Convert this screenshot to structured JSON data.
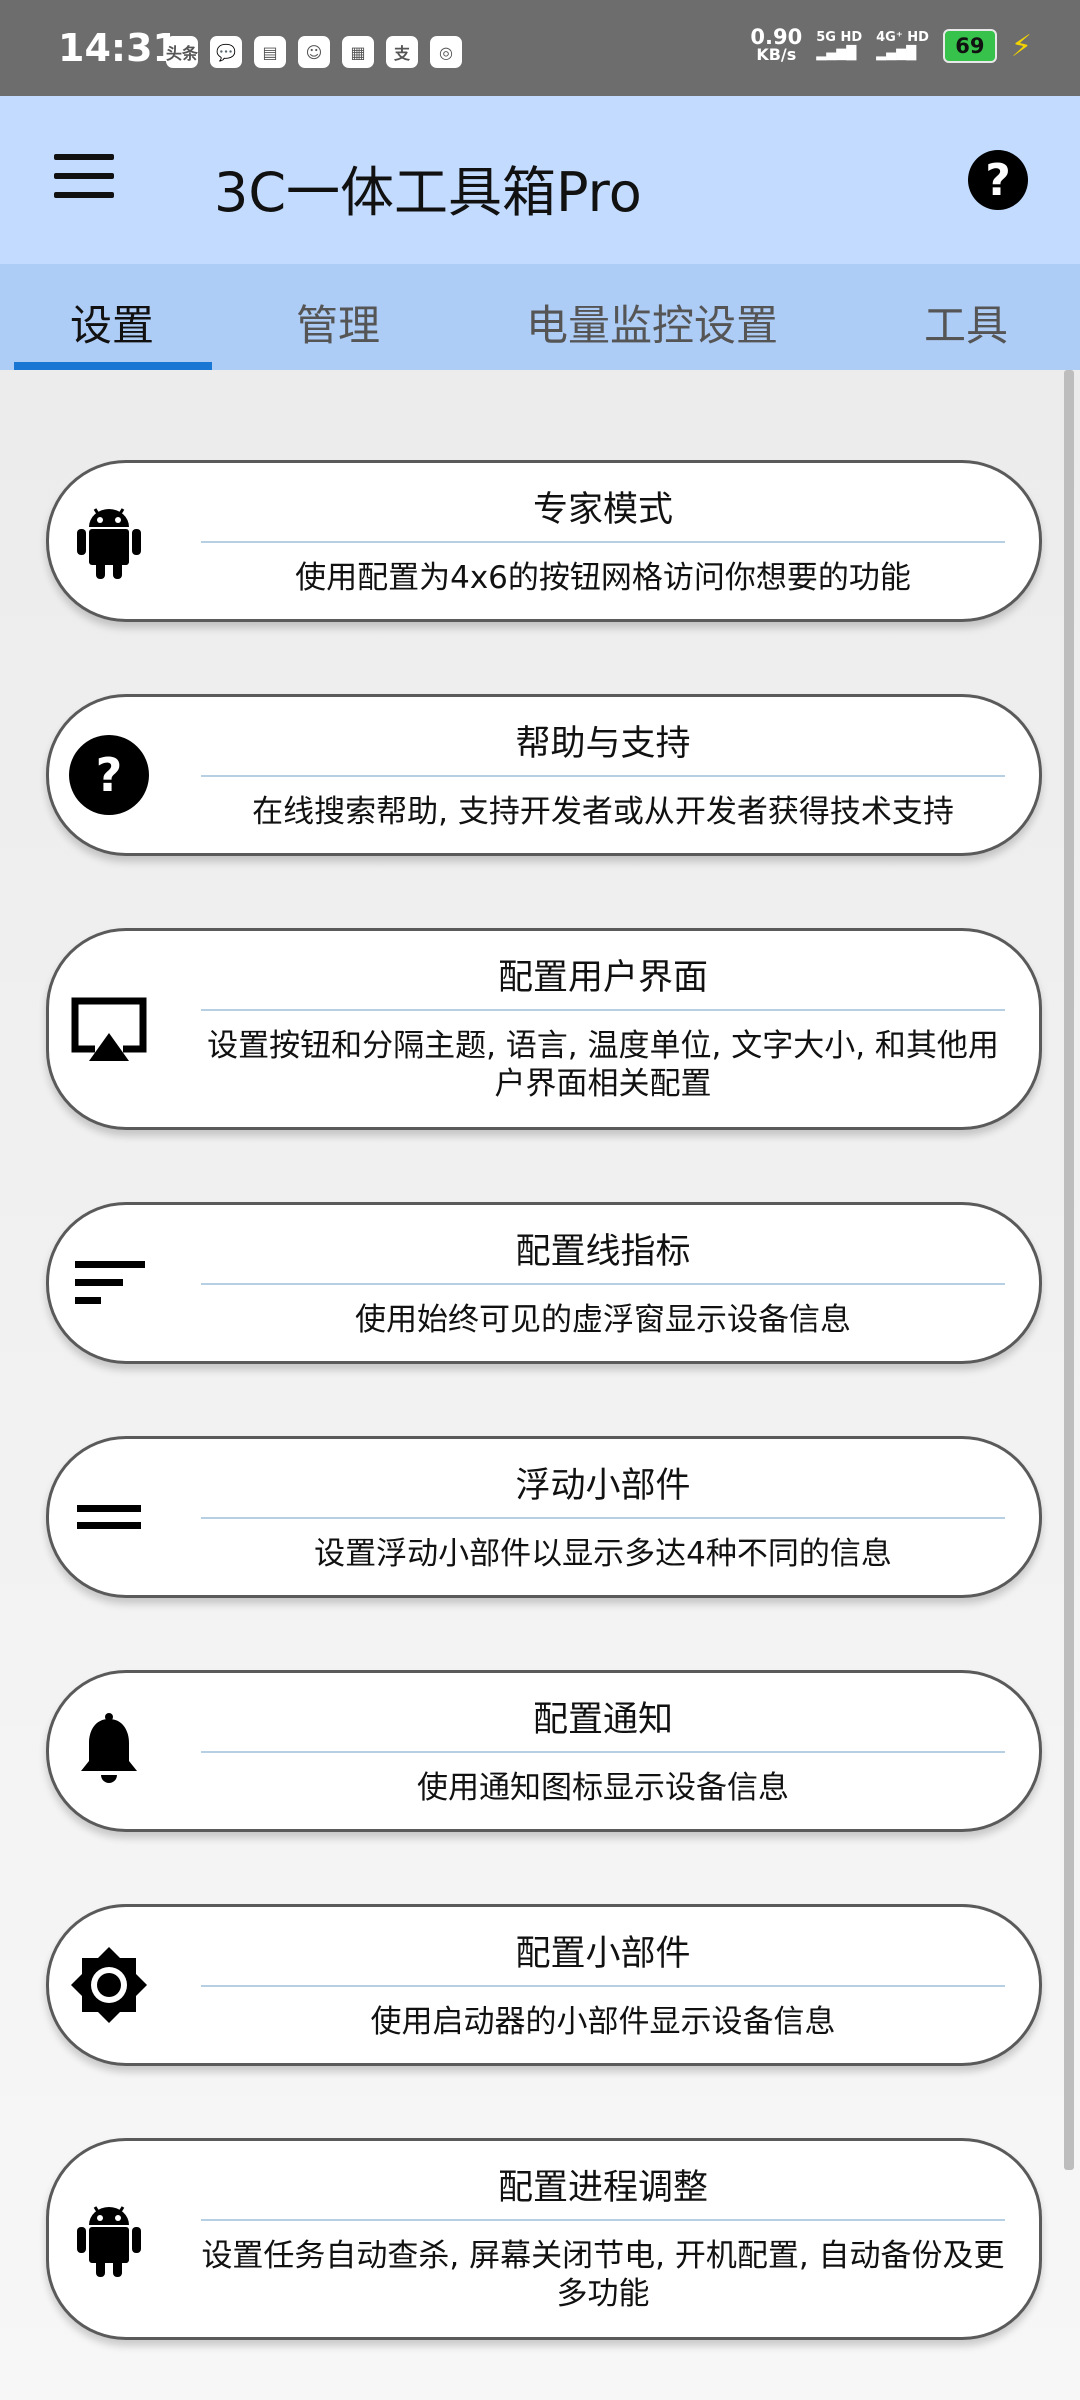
{
  "status_bar": {
    "time": "14:31",
    "app_icons": [
      "头条",
      "💬",
      "▤",
      "☺",
      "▦",
      "支",
      "◎"
    ],
    "net_speed_value": "0.90",
    "net_speed_unit": "KB/s",
    "sim1": "5G HD",
    "sim2": "4G⁺ HD",
    "battery": "69"
  },
  "app_bar": {
    "title": "3C一体工具箱Pro",
    "help_icon": "?"
  },
  "tabs": [
    {
      "label": "设置",
      "active": true
    },
    {
      "label": "管理",
      "active": false
    },
    {
      "label": "电量监控设置",
      "active": false
    },
    {
      "label": "工具",
      "active": false
    }
  ],
  "cards": [
    {
      "icon": "android-icon",
      "title": "专家模式",
      "desc": "使用配置为4x6的按钮网格访问你想要的功能"
    },
    {
      "icon": "help-icon",
      "title": "帮助与支持",
      "desc": "在线搜索帮助, 支持开发者或从开发者获得技术支持"
    },
    {
      "icon": "cast-screen-icon",
      "title": "配置用户界面",
      "desc": "设置按钮和分隔主题, 语言, 温度单位, 文字大小, 和其他用户界面相关配置"
    },
    {
      "icon": "sort-lines-icon",
      "title": "配置线指标",
      "desc": "使用始终可见的虚浮窗显示设备信息"
    },
    {
      "icon": "equals-icon",
      "title": "浮动小部件",
      "desc": "设置浮动小部件以显示多达4种不同的信息"
    },
    {
      "icon": "bell-icon",
      "title": "配置通知",
      "desc": "使用通知图标显示设备信息"
    },
    {
      "icon": "brightness-icon",
      "title": "配置小部件",
      "desc": "使用启动器的小部件显示设备信息"
    },
    {
      "icon": "android-icon",
      "title": "配置进程调整",
      "desc": "设置任务自动查杀, 屏幕关闭节电, 开机配置, 自动备份及更多功能"
    }
  ],
  "colors": {
    "app_bar": "#c2dbff",
    "tab_bar": "#aecdf6",
    "tab_indicator": "#1976d2",
    "card_border": "#5a5a5a",
    "divider": "#b6cfe3"
  }
}
